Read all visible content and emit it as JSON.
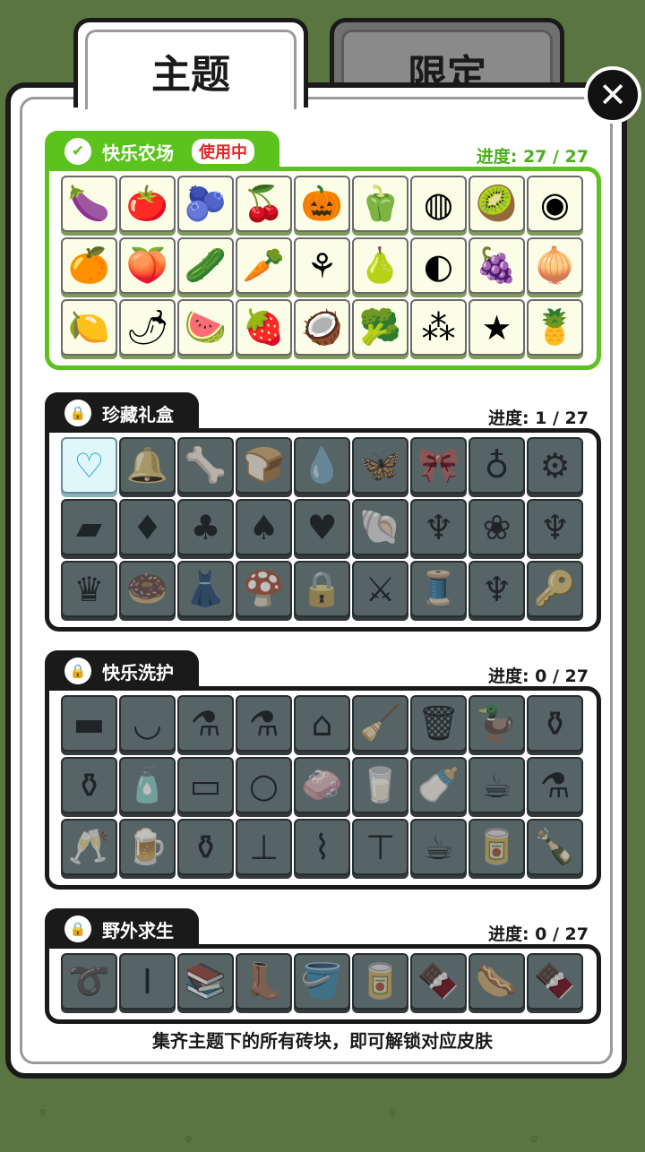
{
  "tabs": {
    "theme": "主题",
    "limited": "限定"
  },
  "close_label": "✕",
  "sections": [
    {
      "name": "快乐农场",
      "badge": "使用中",
      "progress": "进度: 27 / 27",
      "state": "unlocked",
      "accent": "#5cc21c",
      "tiles": [
        "eggplant",
        "tomato",
        "blueberry",
        "cherry",
        "pumpkin",
        "bell-pepper",
        "mangosteen",
        "kiwi",
        "grapefruit",
        "orange",
        "peach",
        "cucumber",
        "carrot",
        "leek",
        "pear",
        "mangosteen-half",
        "grape",
        "onion",
        "lemon",
        "chili",
        "watermelon",
        "strawberry",
        "coconut",
        "broccoli",
        "blackberry",
        "starfruit",
        "pineapple"
      ]
    },
    {
      "name": "珍藏礼盒",
      "progress": "进度: 1 / 27",
      "state": "locked",
      "accent": "#1a1a1a",
      "collected": 1,
      "tiles": [
        "heart-pendant",
        "bell",
        "bone",
        "bread",
        "water-splash",
        "butterfly",
        "bow",
        "perfume",
        "carriage",
        "magic-carpet",
        "card-diamond",
        "card-club",
        "card-spade",
        "card-heart",
        "seashell",
        "coral-orange",
        "rose",
        "coral-pink",
        "crown",
        "donut",
        "dress",
        "mushroom",
        "padlock-purple",
        "sword",
        "thread-spool",
        "coral-purple",
        "key"
      ]
    },
    {
      "name": "快乐洗护",
      "progress": "进度: 0 / 27",
      "state": "locked",
      "accent": "#1a1a1a",
      "tiles": [
        "sponge",
        "basin",
        "spray-bottle",
        "spray-pink",
        "dustpan",
        "broom",
        "trash-can",
        "rubber-duck",
        "detergent",
        "perfume-bottle",
        "lotion",
        "tube",
        "soap-bubbles",
        "bar-soap",
        "glass-cup",
        "milk-bottle",
        "coffee-cup",
        "potion",
        "champagne",
        "beer",
        "syrup",
        "plunger",
        "brush",
        "squeegee",
        "coffee-cup-takeaway",
        "soda-can",
        "cola-bottle"
      ]
    },
    {
      "name": "野外求生",
      "progress": "进度: 0 / 27",
      "state": "locked",
      "accent": "#1a1a1a",
      "tiles": [
        "rope",
        "steel-beam",
        "books",
        "boots",
        "bucket",
        "canned-food",
        "chocolate-bar",
        "sausage",
        "chocolate"
      ]
    }
  ],
  "footer": "集齐主题下的所有砖块，即可解锁对应皮肤"
}
